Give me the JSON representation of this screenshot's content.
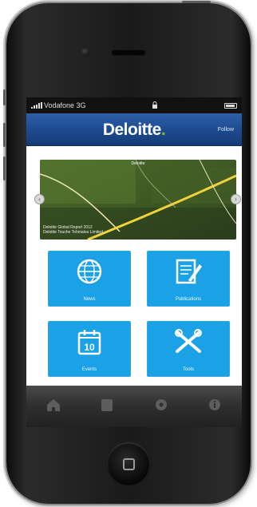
{
  "status_bar": {
    "carrier": "Vodafone 3G",
    "lock_icon": "lock-icon",
    "battery_icon": "battery-icon"
  },
  "navbar": {
    "logo_text": "Deloitte",
    "logo_dot": ".",
    "right_label": "Follow",
    "brand_color": "#1d4a8e",
    "accent_color": "#86bc25"
  },
  "banner": {
    "caption": "Deloitte",
    "note": "Deloitte Global Report 2012\nDeloitte Touche Tohmatsu Limited",
    "prev_icon": "chevron-left-icon",
    "next_icon": "chevron-right-icon"
  },
  "tiles": [
    {
      "label": "News",
      "icon": "globe-icon"
    },
    {
      "label": "Publications",
      "icon": "document-edit-icon"
    },
    {
      "label": "Events",
      "icon": "calendar-icon",
      "day": "10"
    },
    {
      "label": "Tools",
      "icon": "tools-icon"
    }
  ],
  "tile_color": "#1ba1e6",
  "tabbar": {
    "tabs": [
      {
        "icon": "home-icon"
      },
      {
        "icon": "bookmark-icon"
      },
      {
        "icon": "settings-icon"
      },
      {
        "icon": "info-icon"
      }
    ]
  }
}
